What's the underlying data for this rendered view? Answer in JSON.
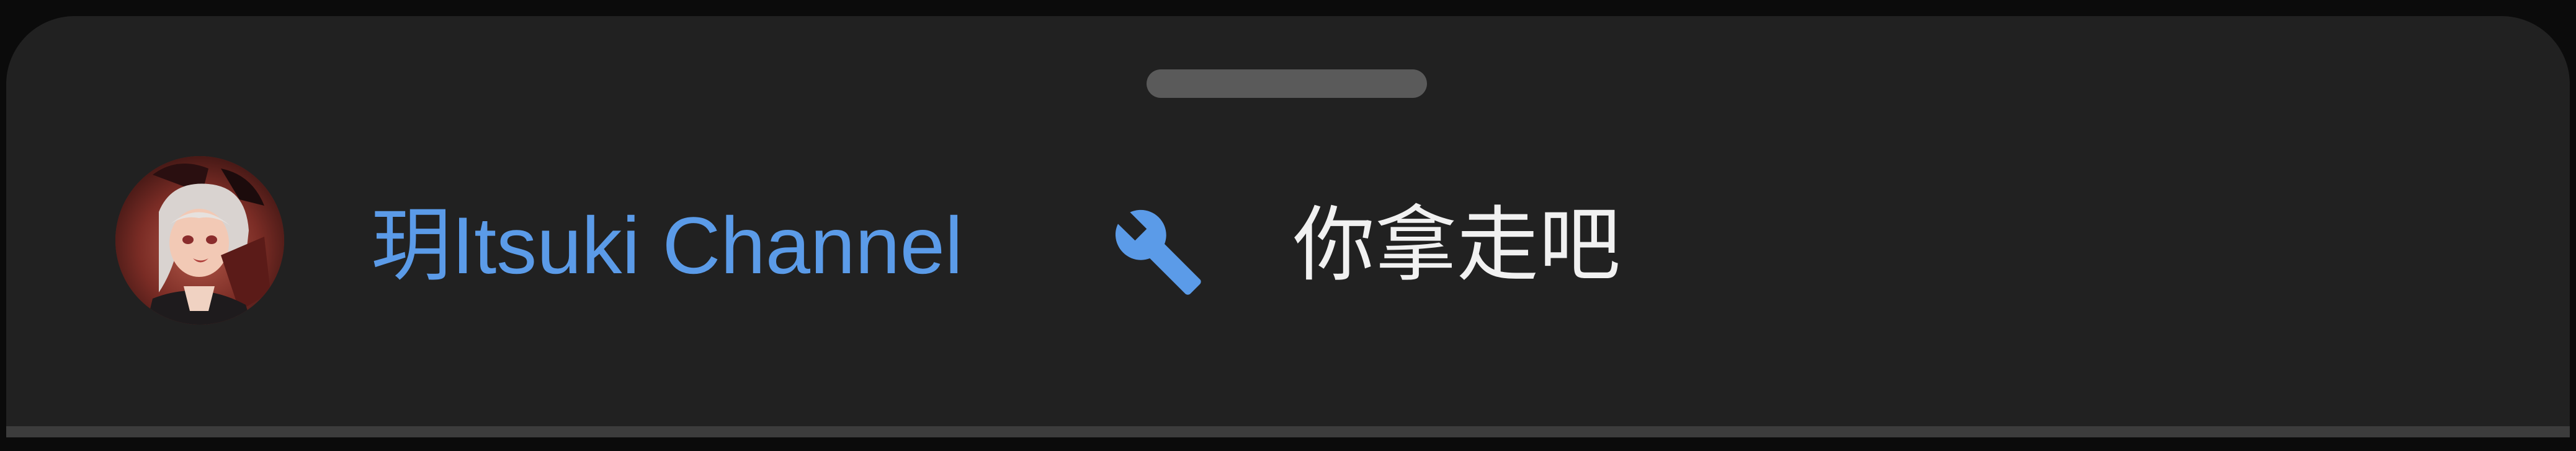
{
  "comment": {
    "author": "玥Itsuki Channel",
    "author_badge_icon": "wrench-icon",
    "text": "你拿走吧"
  },
  "colors": {
    "sheet_background": "#212121",
    "author_name": "#5b9be8",
    "message_text": "#f1f1f1",
    "handle": "#5a5a5a"
  }
}
